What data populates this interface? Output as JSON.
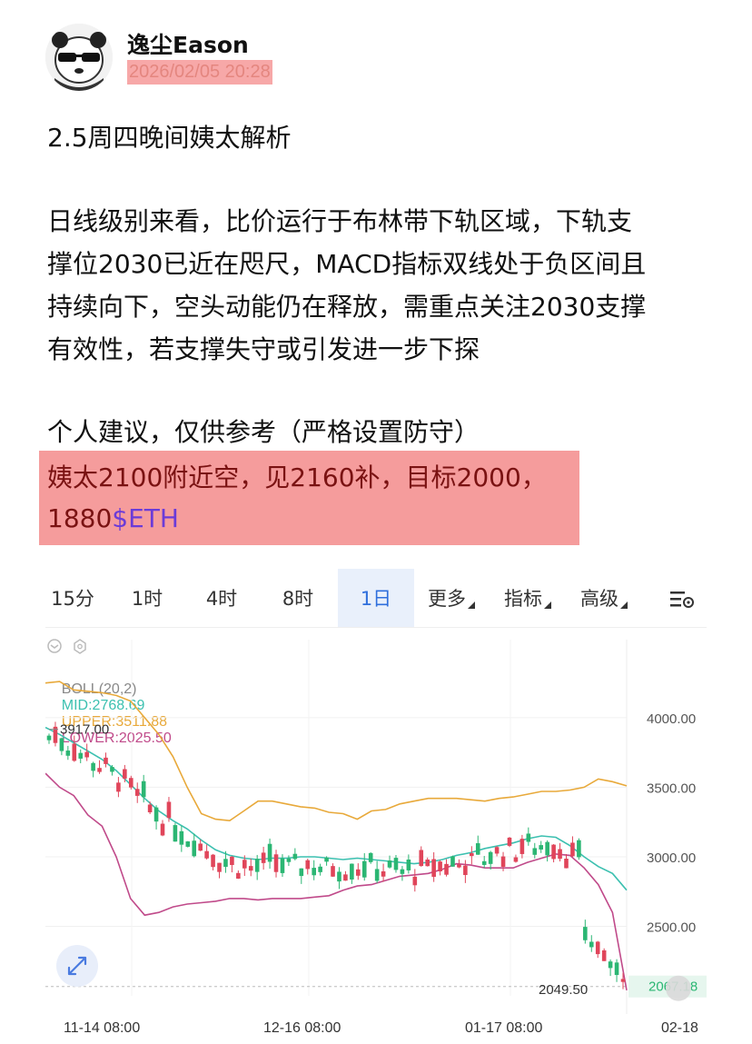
{
  "post": {
    "author": "逸尘Eason",
    "timestamp": "2026/02/05 20:28",
    "title": "2.5周四晚间姨太解析",
    "analysis_lines": [
      "日线级别来看，比价运行于布林带下轨区域，下轨支",
      "撑位2030已近在咫尺，MACD指标双线处于负区间且",
      "持续向下，空头动能仍在释放，需重点关注2030支撑",
      "有效性，若支撑失守或引发进一步下探"
    ],
    "suggestion": "个人建议，仅供参考（严格设置防守）",
    "trade_line1": "姨太2100附近空，见2160补，目标2000，",
    "trade_line2_prefix": "1880",
    "trade_tag": "$ETH"
  },
  "chart": {
    "tabs": [
      "15分",
      "1时",
      "4时",
      "8时",
      "1日",
      "更多",
      "指标",
      "高级"
    ],
    "active_tab": "1日",
    "indicator": {
      "name": "BOLL(20,2)",
      "mid": "MID:2768.69",
      "upper": "UPPER:3511.88",
      "lower": "LOWER:2025.50"
    },
    "colors": {
      "mid": "#3cc0b0",
      "upper": "#e8a93a",
      "lower": "#c04a8a",
      "up": "#2bb673",
      "down": "#e0455a"
    },
    "y_labels": [
      "4000.00",
      "3500.00",
      "3000.00",
      "2500.00"
    ],
    "high_marker": "3917.00",
    "low_marker": "2049.50",
    "last_price": "2067.18",
    "x_labels": [
      "11-14 08:00",
      "12-16 08:00",
      "01-17 08:00",
      "02-18"
    ]
  },
  "chart_data": {
    "type": "candlestick",
    "title": "",
    "ylim": [
      2000,
      4300
    ],
    "x": [
      "11-14 08:00",
      "12-16 08:00",
      "01-17 08:00",
      "02-18"
    ],
    "series": [
      {
        "name": "MID",
        "values": [
          3930,
          3880,
          3820,
          3760,
          3700,
          3620,
          3520,
          3420,
          3330,
          3260,
          3200,
          3120,
          3050,
          3010,
          2990,
          2980,
          2990,
          2990,
          3000,
          3000,
          2990,
          2980,
          2990,
          2980,
          2970,
          2960,
          2950,
          2960,
          2980,
          3010,
          3030,
          3060,
          3080,
          3100,
          3130,
          3150,
          3140,
          3080,
          3000,
          2930,
          2880,
          2760
        ]
      },
      {
        "name": "UPPER",
        "values": [
          4250,
          4260,
          4200,
          4190,
          4180,
          4160,
          4120,
          4000,
          3880,
          3720,
          3500,
          3310,
          3270,
          3260,
          3330,
          3400,
          3400,
          3380,
          3360,
          3350,
          3320,
          3310,
          3270,
          3330,
          3340,
          3380,
          3400,
          3420,
          3420,
          3420,
          3410,
          3400,
          3420,
          3430,
          3450,
          3470,
          3470,
          3480,
          3500,
          3560,
          3540,
          3510
        ]
      },
      {
        "name": "LOWER",
        "values": [
          3600,
          3500,
          3440,
          3300,
          3220,
          3000,
          2700,
          2580,
          2600,
          2640,
          2660,
          2670,
          2680,
          2700,
          2700,
          2690,
          2700,
          2700,
          2700,
          2710,
          2720,
          2760,
          2790,
          2800,
          2830,
          2860,
          2870,
          2880,
          2910,
          2950,
          2940,
          2920,
          2920,
          2920,
          2960,
          2990,
          3020,
          3010,
          2920,
          2800,
          2600,
          2040
        ]
      }
    ]
  }
}
